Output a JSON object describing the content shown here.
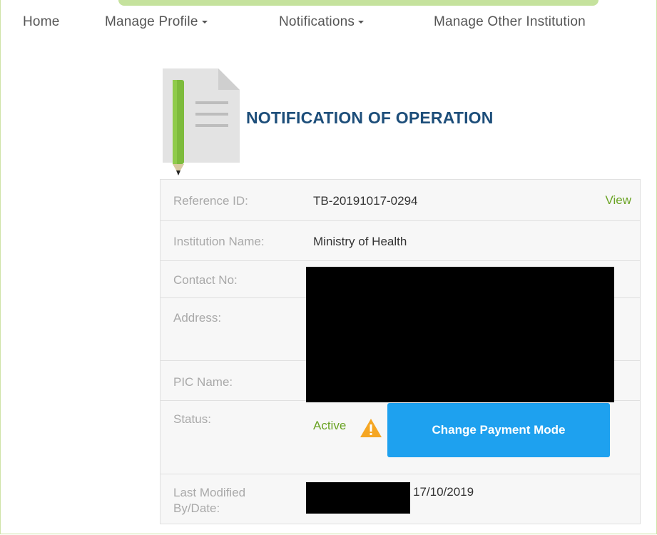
{
  "nav": {
    "home": "Home",
    "manage_profile": "Manage Profile",
    "notifications": "Notifications",
    "manage_other": "Manage Other Institution"
  },
  "page": {
    "title": "NOTIFICATION OF OPERATION"
  },
  "details": {
    "reference_label": "Reference ID:",
    "reference_value": "TB-20191017-0294",
    "view_link": "View",
    "institution_label": "Institution Name:",
    "institution_value": "Ministry of Health",
    "contact_label": "Contact No:",
    "address_label": "Address:",
    "pic_label": "PIC Name:",
    "status_label": "Status:",
    "status_value": "Active",
    "change_payment_button": "Change Payment Mode",
    "last_modified_label_line1": "Last Modified",
    "last_modified_label_line2": "By/Date:",
    "last_modified_date": "17/10/2019"
  },
  "colors": {
    "accent_green": "#6aa324",
    "title_blue": "#1d4e7a",
    "button_blue": "#1ea1ef",
    "warning_orange": "#f5a623"
  }
}
